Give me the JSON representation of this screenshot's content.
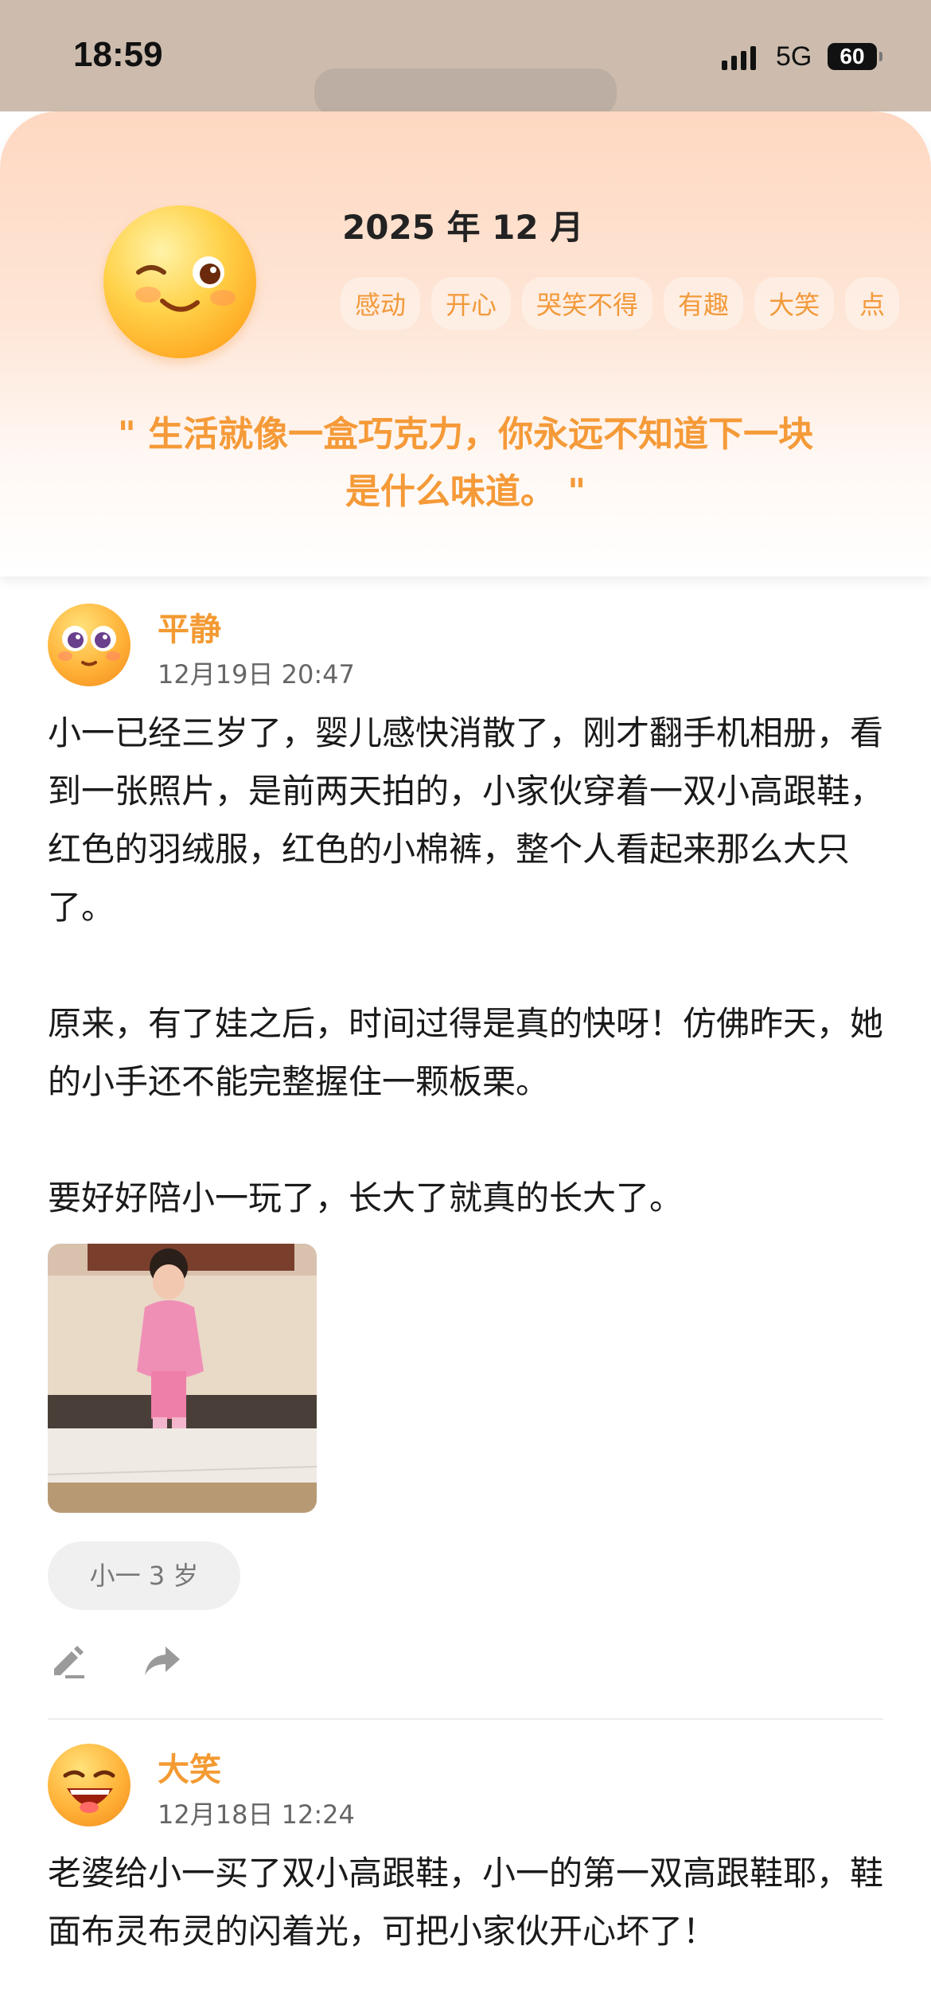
{
  "status_bar": {
    "time": "18:59",
    "network": "5G",
    "battery": "60"
  },
  "header": {
    "month": "2025 年 12 月",
    "tags": [
      "感动",
      "开心",
      "哭笑不得",
      "有趣",
      "大笑",
      "点"
    ],
    "quote_line1": "\" 生活就像一盒巧克力，你永远不知道下一块",
    "quote_line2": "是什么味道。 \""
  },
  "posts": [
    {
      "mood": "平静",
      "date": "12月19日 20:47",
      "paragraphs": [
        "小一已经三岁了，婴儿感快消散了，刚才翻手机相册，看到一张照片，是前两天拍的，小家伙穿着一双小高跟鞋，红色的羽绒服，红色的小棉裤，整个人看起来那么大只了。",
        "原来，有了娃之后，时间过得是真的快呀！仿佛昨天，她的小手还不能完整握住一颗板栗。",
        "要好好陪小一玩了，长大了就真的长大了。"
      ],
      "tag_chip": "小一 3 岁"
    },
    {
      "mood": "大笑",
      "date": "12月18日 12:24",
      "paragraphs": [
        "老婆给小一买了双小高跟鞋，小一的第一双高跟鞋耶，鞋面布灵布灵的闪着光，可把小家伙开心坏了！"
      ]
    }
  ],
  "colors": {
    "accent": "#f39a32",
    "quote": "#f59a38",
    "card_top": "#fed8c1"
  },
  "icons": [
    "wink-emoji-icon",
    "calm-emoji-icon",
    "laugh-emoji-icon",
    "edit-icon",
    "share-icon"
  ]
}
